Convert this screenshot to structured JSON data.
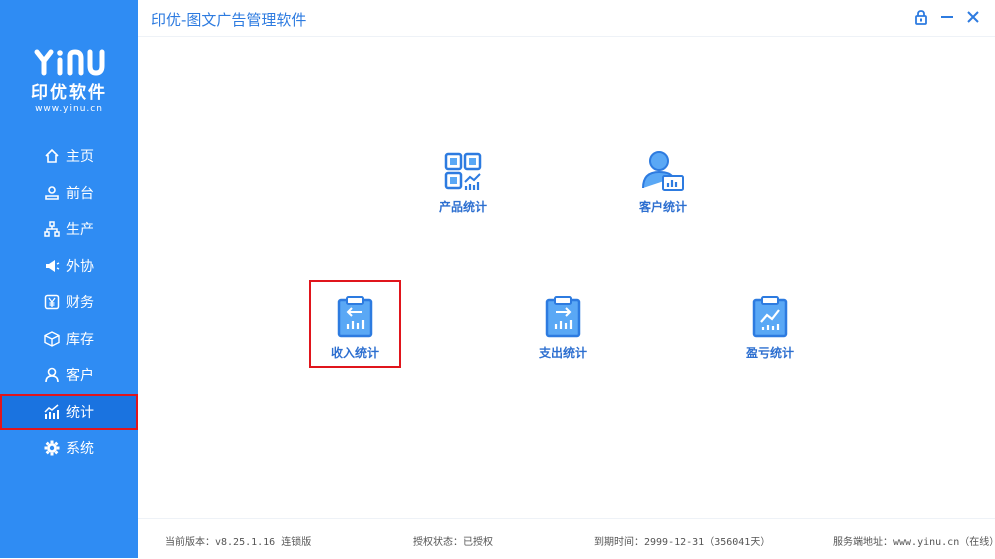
{
  "app": {
    "title": "印优-图文广告管理软件"
  },
  "logo": {
    "mark": "YINU",
    "name": "印优软件",
    "url": "www.yinu.cn"
  },
  "sidebar": {
    "items": [
      {
        "label": "主页",
        "icon": "home-icon"
      },
      {
        "label": "前台",
        "icon": "front-desk-icon"
      },
      {
        "label": "生产",
        "icon": "production-icon"
      },
      {
        "label": "外协",
        "icon": "outsource-icon"
      },
      {
        "label": "财务",
        "icon": "finance-icon"
      },
      {
        "label": "库存",
        "icon": "inventory-icon"
      },
      {
        "label": "客户",
        "icon": "customer-icon"
      },
      {
        "label": "统计",
        "icon": "statistics-icon",
        "active": true
      },
      {
        "label": "系统",
        "icon": "settings-icon"
      }
    ]
  },
  "tiles": {
    "product": {
      "label": "产品统计",
      "icon": "product-stats-icon"
    },
    "customer": {
      "label": "客户统计",
      "icon": "customer-stats-icon"
    },
    "income": {
      "label": "收入统计",
      "icon": "income-stats-icon",
      "highlighted": true
    },
    "expense": {
      "label": "支出统计",
      "icon": "expense-stats-icon"
    },
    "profit": {
      "label": "盈亏统计",
      "icon": "profit-stats-icon"
    }
  },
  "footer": {
    "version": "当前版本：v8.25.1.16  连锁版",
    "license": "授权状态：已授权",
    "expiry": "到期时间：2999-12-31（356041天）",
    "server": "服务端地址：www.yinu.cn（在线）"
  },
  "colors": {
    "sidebar": "#2f8cf3",
    "active": "#1a73e0",
    "highlight": "#e0151c",
    "accent": "#2d7be0"
  }
}
